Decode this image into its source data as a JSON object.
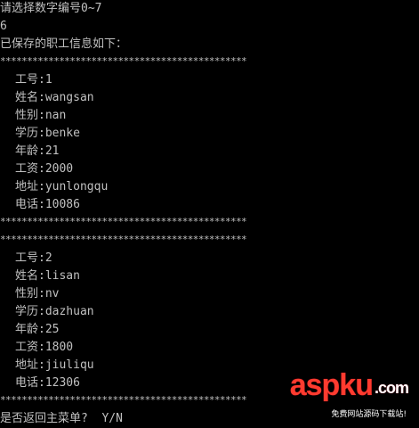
{
  "console": {
    "prompt_line": "请选择数字编号0~7",
    "user_input": "6",
    "saved_title": "已保存的职工信息如下：",
    "separator": "**********************************************",
    "employees": [
      {
        "id_label": "工号:1",
        "name_label": "姓名:wangsan",
        "gender_label": "性别:nan",
        "edu_label": "学历:benke",
        "age_label": "年龄:21",
        "salary_label": "工资:2000",
        "address_label": "地址:yunlongqu",
        "phone_label": "电话:10086"
      },
      {
        "id_label": "工号:2",
        "name_label": "姓名:lisan",
        "gender_label": "性别:nv",
        "edu_label": "学历:dazhuan",
        "age_label": "年龄:25",
        "salary_label": "工资:1800",
        "address_label": "地址:jiuliqu",
        "phone_label": "电话:12306"
      }
    ],
    "return_prompt": "是否返回主菜单?  Y/N"
  },
  "watermark": {
    "brand": "aspku",
    "suffix": ".com",
    "tagline": "免费网站源码下载站!"
  },
  "colors": {
    "background": "#000000",
    "text": "#c0c0c0",
    "watermark_red": "#ff3b2f"
  }
}
